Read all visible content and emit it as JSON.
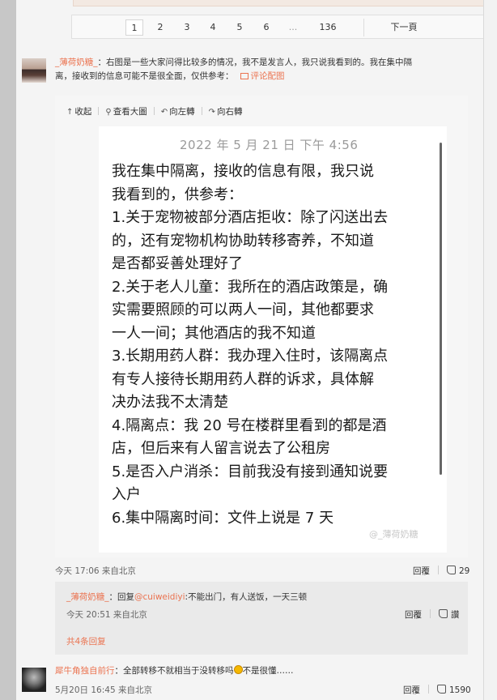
{
  "pagination": {
    "pages": [
      "1",
      "2",
      "3",
      "4",
      "5",
      "6",
      "...",
      "136"
    ],
    "active": "1",
    "next_label": "下一頁"
  },
  "comment1": {
    "username": "_薄荷奶糖_",
    "text": "：右图是一些大家问得比较多的情况，我不是发言人，我只说我看到的。我在集中隔离，接收到的信息可能不是很全面，仅供参考：",
    "text_line1": "：右图是一些大家问得比较多的情况，我不是发言人，我只说我看到的。我在集中隔",
    "text_line2": "离，接收到的信息可能不是很全面，仅供参考：",
    "image_link": "评论配图",
    "meta": "今天 17:06 来自北京",
    "reply_label": "回覆",
    "like_count": "29"
  },
  "image_toolbar": {
    "collapse": "收起",
    "view_large": "查看大圖",
    "rotate_left": "向左轉",
    "rotate_right": "向右轉"
  },
  "screenshot": {
    "date": "2022 年 5 月 21 日  下午 4:56",
    "lines": [
      "我在集中隔离，接收的信息有限，我只说",
      "我看到的，供参考：",
      "1.关于宠物被部分酒店拒收：除了闪送出去",
      "的，还有宠物机构协助转移寄养，不知道",
      "是否都妥善处理好了",
      "2.关于老人儿童：我所在的酒店政策是，确",
      "实需要照顾的可以两人一间，其他都要求",
      "一人一间；其他酒店的我不知道",
      "3.长期用药人群：我办理入住时，该隔离点",
      "有专人接待长期用药人群的诉求，具体解",
      "决办法我不太清楚",
      "4.隔离点：我 20 号在楼群里看到的都是酒",
      "店，但后来有人留言说去了公租房",
      "5.是否入户消杀：目前我没有接到通知说要",
      "入户",
      "6.集中隔离时间：文件上说是 7 天"
    ],
    "watermark": "@_薄荷奶糖"
  },
  "reply": {
    "username": "_薄荷奶糖_",
    "prefix": "：回复",
    "mention": "@cuiweidiyi",
    "text": ":不能出门，有人送饭，一天三顿",
    "meta": "今天 20:51 来自北京",
    "reply_label": "回覆",
    "like_label": "讚",
    "more": "共4条回复"
  },
  "comment2": {
    "username": "犀牛角独自前行",
    "text_before": "：全部转移不就相当于没转移吗",
    "text_after": "不是很懂……",
    "meta": "5月20日 16:45 来自北京",
    "reply_label": "回覆",
    "like_count": "1590"
  },
  "colors": {
    "accent": "#eb7350",
    "background": "#f4f4f4"
  }
}
